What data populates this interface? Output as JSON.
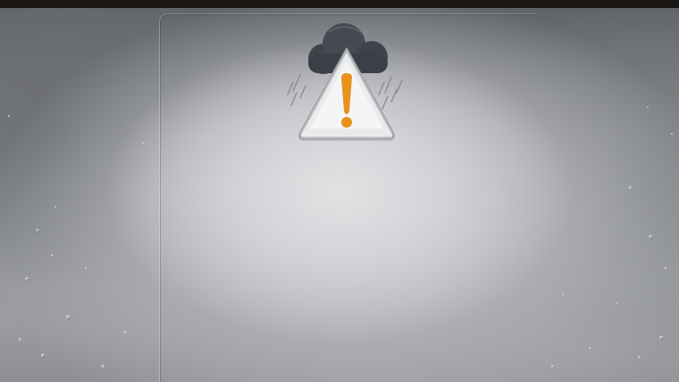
{
  "alert": {
    "icon": "severe-weather-warning-icon",
    "accent_color": "#e8911d",
    "cloud_color": "#3e434b"
  },
  "background": {
    "scene": "rain-clouds-wallpaper"
  }
}
